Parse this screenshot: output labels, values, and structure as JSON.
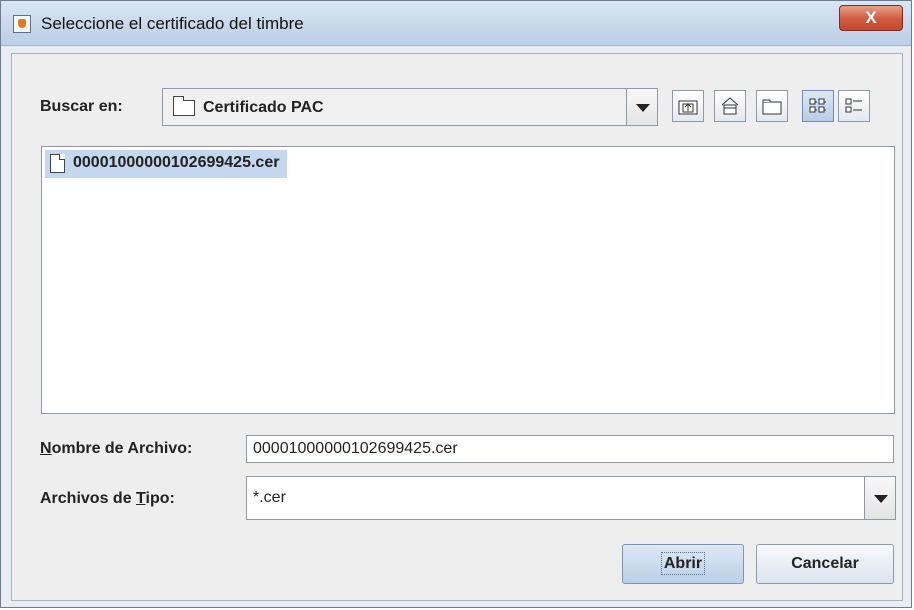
{
  "window": {
    "title": "Seleccione el certificado del timbre",
    "close_glyph": "X"
  },
  "lookin": {
    "label": "Buscar en:",
    "value": "Certificado PAC"
  },
  "toolbar": {
    "icons": [
      "up-folder-icon",
      "home-icon",
      "new-folder-icon",
      "list-view-icon",
      "details-view-icon"
    ],
    "selected_view": "list-view"
  },
  "files": [
    {
      "name": "00001000000102699425.cer",
      "selected": true
    }
  ],
  "filename": {
    "label_mnemonic": "N",
    "label_rest": "ombre de Archivo:",
    "value": "00001000000102699425.cer"
  },
  "filetype": {
    "label_prefix": "Archivos de ",
    "label_mnemonic": "T",
    "label_rest": "ipo:",
    "value": "*.cer"
  },
  "buttons": {
    "open": "Abrir",
    "cancel": "Cancelar"
  }
}
